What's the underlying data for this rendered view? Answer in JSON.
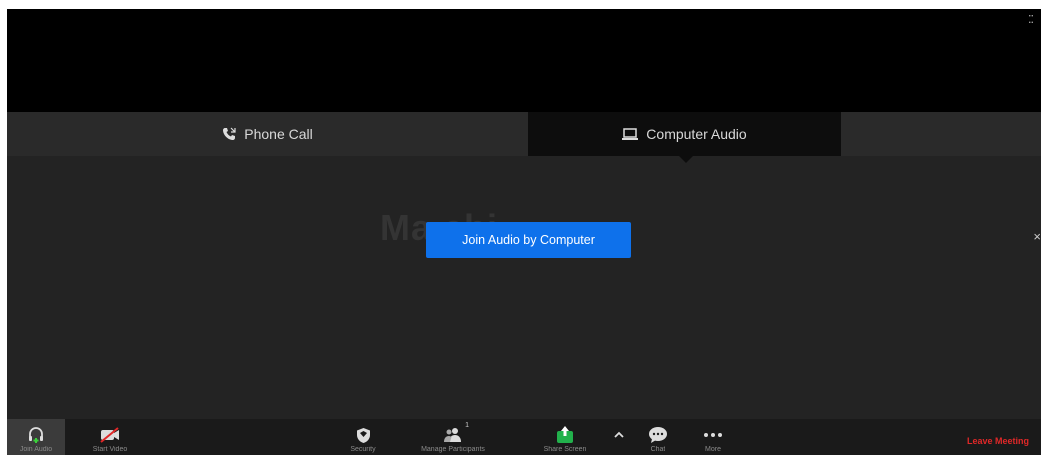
{
  "audio": {
    "phone_tab": "Phone Call",
    "computer_tab": "Computer Audio",
    "join_button": "Join Audio by Computer",
    "close": "×"
  },
  "participant": {
    "name": "Ma           chi"
  },
  "toolbar": {
    "join_audio": "Join Audio",
    "start_video": "Start Video",
    "security": "Security",
    "participants": "Manage Participants",
    "participant_count": "1",
    "share_screen": "Share Screen",
    "chat": "Chat",
    "more": "More",
    "leave": "Leave Meeting"
  },
  "colors": {
    "accent": "#0e71eb",
    "leave": "#e02828",
    "share": "#22b14c",
    "background": "#232323"
  },
  "icons": {
    "fullscreen": "fullscreen-icon",
    "phone": "phone-icon",
    "computer": "laptop-icon",
    "headphone": "headphone-icon",
    "video_off": "video-off-icon",
    "shield": "shield-icon",
    "participants": "participants-icon",
    "share": "share-screen-icon",
    "caret_up": "chevron-up-icon",
    "chat": "chat-icon",
    "more": "more-icon"
  }
}
